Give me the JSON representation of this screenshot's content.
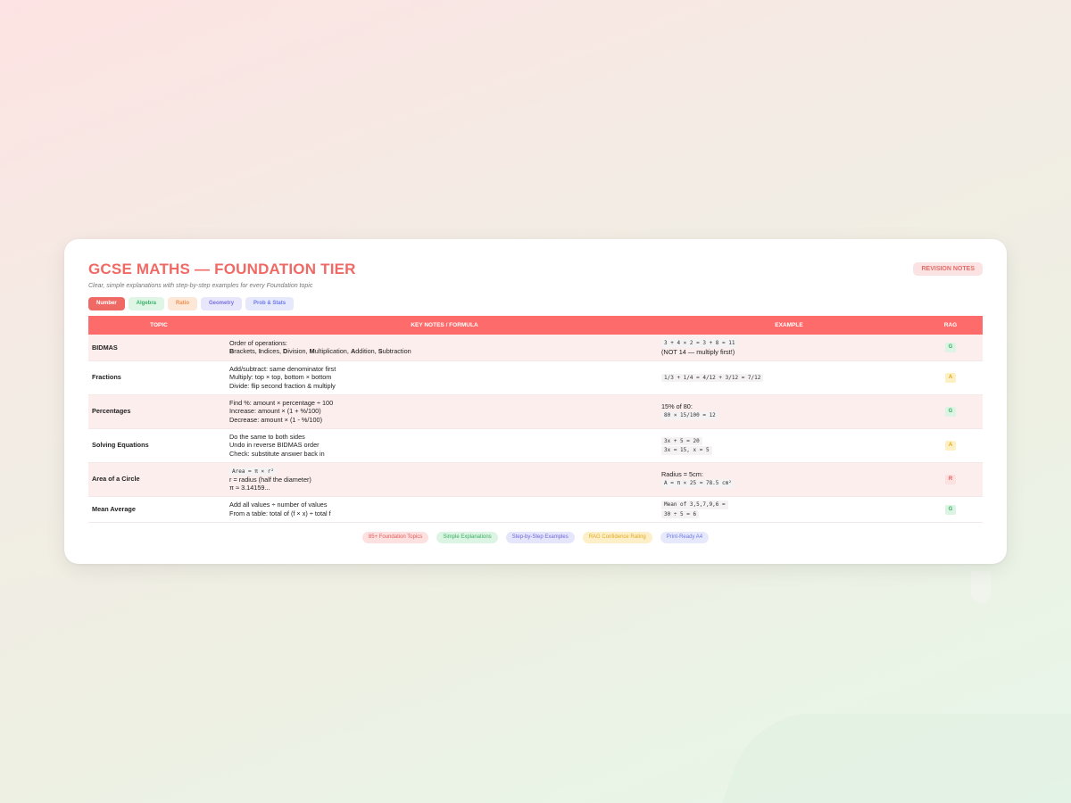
{
  "header": {
    "title": "GCSE MATHS — FOUNDATION TIER",
    "subtitle": "Clear, simple explanations with step-by-step examples for every Foundation topic",
    "badge": "REVISION NOTES"
  },
  "tabs": [
    "Number",
    "Algebra",
    "Ratio",
    "Geometry",
    "Prob & Stats"
  ],
  "table": {
    "headers": [
      "TOPIC",
      "KEY NOTES / FORMULA",
      "EXAMPLE",
      "RAG"
    ],
    "rows": [
      {
        "topic": "BIDMAS",
        "notes": [
          "Order of operations:",
          "Brackets, Indices, Division, Multiplication, Addition, Subtraction"
        ],
        "example_code": [
          "3 + 4 × 2 = 3 + 8 = 11"
        ],
        "example_text": [
          "(NOT 14 — multiply first!)"
        ],
        "rag": "G"
      },
      {
        "topic": "Fractions",
        "notes": [
          "Add/subtract: same denominator first",
          "Multiply: top × top, bottom × bottom",
          "Divide: flip second fraction & multiply"
        ],
        "example_code": [
          "1/3 + 1/4 = 4/12 + 3/12 = 7/12"
        ],
        "example_text": [],
        "rag": "A"
      },
      {
        "topic": "Percentages",
        "notes": [
          "Find %: amount × percentage ÷ 100",
          "Increase: amount × (1 + %/100)",
          "Decrease: amount × (1 - %/100)"
        ],
        "example_text_pre": [
          "15% of 80:"
        ],
        "example_code": [
          "80 × 15/100 = 12"
        ],
        "rag": "G"
      },
      {
        "topic": "Solving Equations",
        "notes": [
          "Do the same to both sides",
          "Undo in reverse BIDMAS order",
          "Check: substitute answer back in"
        ],
        "example_code": [
          "3x + 5 = 20",
          "3x = 15, x = 5"
        ],
        "rag": "A"
      },
      {
        "topic": "Area of a Circle",
        "notes_code": [
          "Area = π × r²"
        ],
        "notes": [
          "r = radius (half the diameter)",
          "π ≈ 3.14159..."
        ],
        "example_text_pre": [
          "Radius = 5cm:"
        ],
        "example_code": [
          "A = π × 25 ≈ 78.5 cm²"
        ],
        "rag": "R"
      },
      {
        "topic": "Mean Average",
        "notes": [
          "Add all values ÷ number of values",
          "From a table: total of (f × x) ÷ total f"
        ],
        "example_code": [
          "Mean of 3,5,7,9,6 =",
          "30 ÷ 5 = 6"
        ],
        "rag": "G"
      }
    ]
  },
  "footer_pills": [
    "85+ Foundation Topics",
    "Simple Explanations",
    "Step-by-Step Examples",
    "RAG Confidence Rating",
    "Print-Ready A4"
  ]
}
